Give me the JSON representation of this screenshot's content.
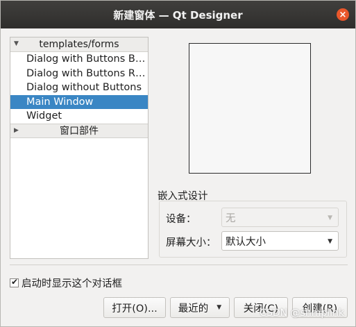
{
  "window": {
    "title": "新建窗体 — Qt Designer",
    "close_glyph": "×"
  },
  "templates": {
    "group1": {
      "label": "templates/forms",
      "items": [
        {
          "label": "Dialog with Buttons Bo…",
          "selected": false
        },
        {
          "label": "Dialog with Buttons Ri…",
          "selected": false
        },
        {
          "label": "Dialog without Buttons",
          "selected": false
        },
        {
          "label": "Main Window",
          "selected": true
        },
        {
          "label": "Widget",
          "selected": false
        }
      ]
    },
    "group2": {
      "label": "窗口部件"
    }
  },
  "embedded_design": {
    "title": "嵌入式设计",
    "device_label": "设备：",
    "device_value": "无",
    "screen_size_label": "屏幕大小：",
    "screen_size_value": "默认大小"
  },
  "show_on_startup": {
    "label": "启动时显示这个对话框",
    "checked": true
  },
  "buttons": {
    "open": "打开(O)...",
    "recent": "最近的",
    "close": "关闭(C)",
    "create": "创建(R)"
  },
  "watermark": "CSDN @shmplink",
  "colors": {
    "selection": "#3a86c4",
    "titlebar": "#333231",
    "close_button": "#e9572b"
  }
}
